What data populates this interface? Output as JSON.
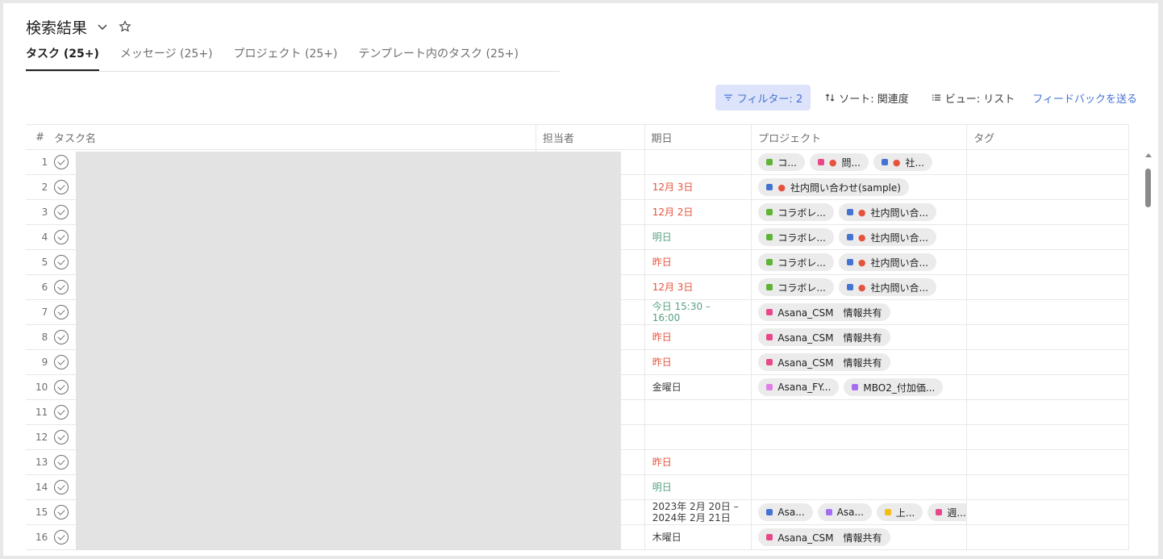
{
  "header": {
    "title": "検索結果"
  },
  "tabs": [
    {
      "label": "タスク (25+)",
      "active": true
    },
    {
      "label": "メッセージ (25+)",
      "active": false
    },
    {
      "label": "プロジェクト (25+)",
      "active": false
    },
    {
      "label": "テンプレート内のタスク (25+)",
      "active": false
    }
  ],
  "toolbar": {
    "filter_label": "フィルター: 2",
    "sort_label": "ソート: 関連度",
    "view_label": "ビュー: リスト",
    "feedback_label": "フィードバックを送る"
  },
  "table": {
    "columns": {
      "num": "#",
      "name": "タスク名",
      "assignee": "担当者",
      "due": "期日",
      "project": "プロジェクト",
      "tag": "タグ"
    },
    "rows": [
      {
        "num": "1",
        "due": "",
        "due_color": "gray",
        "projects": [
          {
            "label": "コ...",
            "color": "#5fb336"
          },
          {
            "label": "問...",
            "color": "#e8488a",
            "pin": true
          },
          {
            "label": "社...",
            "color": "#4573d2",
            "pin": true
          }
        ]
      },
      {
        "num": "2",
        "due": "12月 3日",
        "due_color": "red",
        "projects": [
          {
            "label": "社内問い合わせ(sample)",
            "color": "#4573d2",
            "pin": true
          }
        ]
      },
      {
        "num": "3",
        "due": "12月 2日",
        "due_color": "red",
        "projects": [
          {
            "label": "コラボレ...",
            "color": "#5fb336"
          },
          {
            "label": "社内問い合...",
            "color": "#4573d2",
            "pin": true
          }
        ]
      },
      {
        "num": "4",
        "due": "明日",
        "due_color": "green",
        "projects": [
          {
            "label": "コラボレ...",
            "color": "#5fb336"
          },
          {
            "label": "社内問い合...",
            "color": "#4573d2",
            "pin": true
          }
        ]
      },
      {
        "num": "5",
        "due": "昨日",
        "due_color": "red",
        "projects": [
          {
            "label": "コラボレ...",
            "color": "#5fb336"
          },
          {
            "label": "社内問い合...",
            "color": "#4573d2",
            "pin": true
          }
        ]
      },
      {
        "num": "6",
        "due": "12月 3日",
        "due_color": "red",
        "projects": [
          {
            "label": "コラボレ...",
            "color": "#5fb336"
          },
          {
            "label": "社内問い合...",
            "color": "#4573d2",
            "pin": true
          }
        ]
      },
      {
        "num": "7",
        "due": "今日 15:30 – 16:00",
        "due_color": "green",
        "projects": [
          {
            "label": "Asana_CSM　情報共有",
            "color": "#e8488a"
          }
        ]
      },
      {
        "num": "8",
        "due": "昨日",
        "due_color": "red",
        "projects": [
          {
            "label": "Asana_CSM　情報共有",
            "color": "#e8488a"
          }
        ]
      },
      {
        "num": "9",
        "due": "昨日",
        "due_color": "red",
        "projects": [
          {
            "label": "Asana_CSM　情報共有",
            "color": "#e8488a"
          }
        ]
      },
      {
        "num": "10",
        "due": "金曜日",
        "due_color": "gray",
        "projects": [
          {
            "label": "Asana_FY...",
            "color": "#e37ee8"
          },
          {
            "label": "MBO2_付加価...",
            "color": "#a56ef0"
          }
        ]
      },
      {
        "num": "11",
        "due": "",
        "due_color": "gray",
        "projects": []
      },
      {
        "num": "12",
        "due": "",
        "due_color": "gray",
        "projects": []
      },
      {
        "num": "13",
        "due": "昨日",
        "due_color": "red",
        "projects": []
      },
      {
        "num": "14",
        "due": "明日",
        "due_color": "green",
        "projects": []
      },
      {
        "num": "15",
        "due": "2023年 2月 20日 – 2024年 2月 21日",
        "due_color": "gray",
        "projects": [
          {
            "label": "Asa...",
            "color": "#4573d2"
          },
          {
            "label": "Asa...",
            "color": "#a56ef0"
          },
          {
            "label": "上...",
            "color": "#f1bd16"
          },
          {
            "label": "週...",
            "color": "#e8488a"
          }
        ]
      },
      {
        "num": "16",
        "due": "木曜日",
        "due_color": "gray",
        "projects": [
          {
            "label": "Asana_CSM　情報共有",
            "color": "#e8488a"
          }
        ]
      }
    ]
  }
}
